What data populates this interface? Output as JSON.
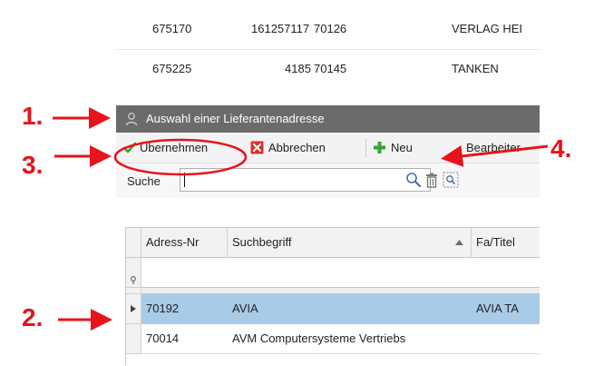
{
  "background_rows": [
    {
      "c1": "675170",
      "c2": "161257117",
      "c3": "70126",
      "c4": "VERLAG HEI"
    },
    {
      "c1": "675225",
      "c2": "4185",
      "c3": "70145",
      "c4": "TANKEN"
    }
  ],
  "dialog": {
    "title": "Auswahl einer Lieferantenadresse",
    "toolbar": {
      "accept": "Übernehmen",
      "cancel": "Abbrechen",
      "new": "Neu",
      "edit": "Bearbeiter"
    },
    "search": {
      "label": "Suche",
      "value": ""
    },
    "grid": {
      "columns": [
        "Adress-Nr",
        "Suchbegriff",
        "Fa/Titel"
      ],
      "rows": [
        {
          "adress_nr": "70192",
          "suchbegriff": "AVIA",
          "titel": "AVIA TA",
          "selected": true
        },
        {
          "adress_nr": "70014",
          "suchbegriff": "AVM Computersysteme Vertriebs",
          "titel": "",
          "selected": false
        }
      ]
    }
  },
  "annotations": {
    "n1": "1.",
    "n2": "2.",
    "n3": "3.",
    "n4": "4."
  },
  "colors": {
    "title_bar": "#6b6b6b",
    "selected_row": "#a8cbe8",
    "annotation": "#e8131b",
    "accept_check": "#3aa335",
    "cancel_x": "#d9322e",
    "new_plus": "#3aa335"
  }
}
